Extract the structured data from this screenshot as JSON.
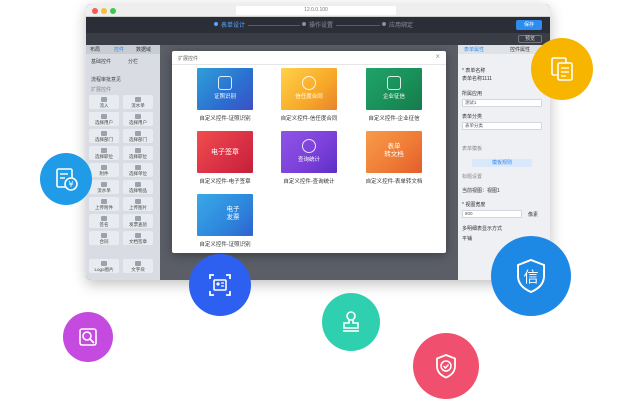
{
  "browser": {
    "url": "12.0.0.100"
  },
  "appbar": {
    "steps": [
      "表单设计",
      "操作设置",
      "应用绑定"
    ],
    "save_label": "保存",
    "preview_label": "预览"
  },
  "left_panel": {
    "tabs": [
      "布局",
      "控件",
      "数据域"
    ],
    "rows": [
      [
        "基础控件",
        "分栏"
      ],
      [
        "流程审批意见"
      ],
      [
        "扩展控件"
      ]
    ],
    "cells": [
      "流入",
      "流水单",
      "选择用户",
      "选择用户",
      "选择部门",
      "选择部门",
      "选择职位",
      "选择职位",
      "附件",
      "选择单位",
      "流水单",
      "选择物品",
      "上传附件",
      "上传图片",
      "签名",
      "发票查验",
      "合同",
      "文档签章",
      "Logo图片",
      "文字块"
    ]
  },
  "right_panel": {
    "tabs": [
      "表单属性",
      "控件属性"
    ],
    "form_name_label": "* 表单名称",
    "form_name_value": "表单名称1111",
    "app_label": "所属应用",
    "app_value": "测试1",
    "category_label": "表单分类",
    "category_value": "表单分类",
    "template_label": "表单模板",
    "button_label": "模板规则",
    "title_label": "标题设置",
    "current_view_label": "当前视图：",
    "current_view_value": "视图1",
    "width_label": "* 视图宽度",
    "width_value": "800",
    "width_unit": "像素",
    "layout_label": "多明细表显示方式",
    "layout_value": "平铺"
  },
  "modal": {
    "title": "扩展控件",
    "close": "×",
    "tiles": [
      {
        "text": "证照识别",
        "caption": "自定义控件-证照识别"
      },
      {
        "text": "信任度合同",
        "caption": "自定义控件-信任度合同"
      },
      {
        "text": "企业征信",
        "caption": "自定义控件-企业征信"
      },
      {
        "text": "电子签章",
        "caption": "自定义控件-电子签章"
      },
      {
        "text": "查询统计",
        "caption": "自定义控件-查询统计"
      },
      {
        "text": "表单\n转文档",
        "caption": "自定义控件-表单转文档"
      },
      {
        "text": "电子\n发票",
        "caption": "自定义控件-证照识别"
      }
    ]
  },
  "floating_icons": [
    {
      "name": "invoice-icon",
      "color": "#1f9be8",
      "glyph": "¥"
    },
    {
      "name": "id-card-icon",
      "color": "#2d5ff0"
    },
    {
      "name": "document-copy-icon",
      "color": "#f8b500"
    },
    {
      "name": "credit-icon",
      "color": "#1e88e5",
      "glyph": "信"
    },
    {
      "name": "stamp-icon",
      "color": "#2fd0b0"
    },
    {
      "name": "search-stats-icon",
      "color": "#c44ae0"
    },
    {
      "name": "shield-check-icon",
      "color": "#f0506e"
    }
  ]
}
